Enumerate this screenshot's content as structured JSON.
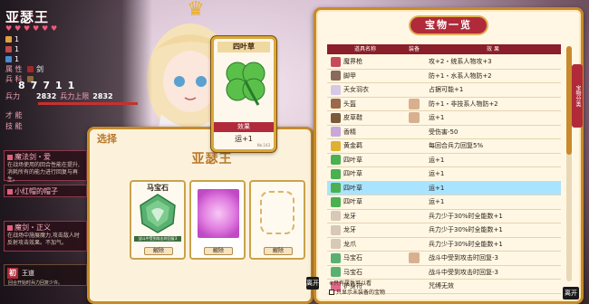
{
  "hero": {
    "name": "亚瑟王",
    "stats": [
      {
        "key": "1",
        "value": "1"
      },
      {
        "key": "1",
        "value": "1"
      },
      {
        "key": "1",
        "value": "1"
      }
    ],
    "attr_row": {
      "label_attr": "属 性",
      "label_weapon": "剑"
    },
    "class_row": {
      "label": "兵 科"
    },
    "five": [
      "8",
      "7",
      "7",
      "1",
      "1"
    ],
    "hp_label": "兵力",
    "hp_value": "2832",
    "hp_max_label": "兵力上限",
    "hp_max_value": "2832",
    "skill_labels": [
      "才 能",
      "技 能"
    ],
    "skill1_title": "魔法剑・爱",
    "skill1_desc": "在战场使用的回合性能在提升,消耗所有的能力进行回复与再生。",
    "skill2_title": "小红帽的帽子",
    "skill2_desc": "",
    "skill3_title": "魔剑・正义",
    "skill3_desc": "在战场中施展魔力,攻击敌人时反射攻击效果。不加气。",
    "kingdom_seal": "初",
    "kingdom_label": "王道",
    "kingdom_sub": "回合开始时兵力回复少许。"
  },
  "crown_icon": "crown-icon",
  "item_card": {
    "title": "四叶草",
    "effect_label": "效果",
    "effect": "运+1",
    "number": "No.143"
  },
  "equip_dialog": {
    "title": "选择",
    "hero_name": "亚瑟王",
    "slots": [
      {
        "name": "马宝石",
        "desc": "战斗中受到攻击时回复3",
        "unequip": "解除"
      },
      {
        "name": "",
        "desc": "",
        "unequip": "解除"
      },
      {
        "name": "",
        "desc": "",
        "unequip": "解除"
      }
    ]
  },
  "treasure_list": {
    "title": "宝物一览",
    "headers": {
      "name": "道具名称",
      "equip": "装备",
      "effect": "效 果"
    },
    "side_tab": "宝物分类",
    "close": "离开",
    "footer_note": "※只有属性可以看",
    "footer_check": "只显示未装备的宝物",
    "rows": [
      {
        "name": "魔界枪",
        "icon_color": "#c84a5a",
        "equip": false,
        "effect": "攻+2・统系人物攻+3"
      },
      {
        "name": "脚甲",
        "icon_color": "#8a6a5a",
        "equip": false,
        "effect": "防+1・水系人物防+2"
      },
      {
        "name": "天女羽衣",
        "icon_color": "#d8c8e8",
        "equip": false,
        "effect": "占据可能+1"
      },
      {
        "name": "头盔",
        "icon_color": "#9a6a4a",
        "equip": true,
        "effect": "防+1・非技系人物防+2"
      },
      {
        "name": "皮草鞋",
        "icon_color": "#7a5a3a",
        "equip": true,
        "effect": "运+1"
      },
      {
        "name": "香精",
        "icon_color": "#c8a8d8",
        "equip": false,
        "effect": "受伤害-50"
      },
      {
        "name": "黄金羁",
        "icon_color": "#e0b030",
        "equip": false,
        "effect": "每回合兵力回复5%"
      },
      {
        "name": "四叶草",
        "icon_color": "#4ab050",
        "equip": false,
        "effect": "运+1"
      },
      {
        "name": "四叶草",
        "icon_color": "#4ab050",
        "equip": false,
        "effect": "运+1"
      },
      {
        "name": "四叶草",
        "icon_color": "#4ab050",
        "equip": false,
        "effect": "运+1",
        "highlight": true
      },
      {
        "name": "四叶草",
        "icon_color": "#4ab050",
        "equip": false,
        "effect": "运+1"
      },
      {
        "name": "龙牙",
        "icon_color": "#d8c8b8",
        "equip": false,
        "effect": "兵力少于30%时全能数+1"
      },
      {
        "name": "龙牙",
        "icon_color": "#d8c8b8",
        "equip": false,
        "effect": "兵力少于30%时全能数+1"
      },
      {
        "name": "龙爪",
        "icon_color": "#d8c8b8",
        "equip": false,
        "effect": "兵力少于30%时全能数+1"
      },
      {
        "name": "马宝石",
        "icon_color": "#5ab070",
        "equip": true,
        "effect": "战斗中受到攻击时回复-3"
      },
      {
        "name": "马宝石",
        "icon_color": "#5ab070",
        "equip": false,
        "effect": "战斗中受到攻击时回复-3"
      },
      {
        "name": "护身符",
        "icon_color": "#e06a8a",
        "equip": false,
        "effect": "咒缚无效"
      }
    ]
  }
}
